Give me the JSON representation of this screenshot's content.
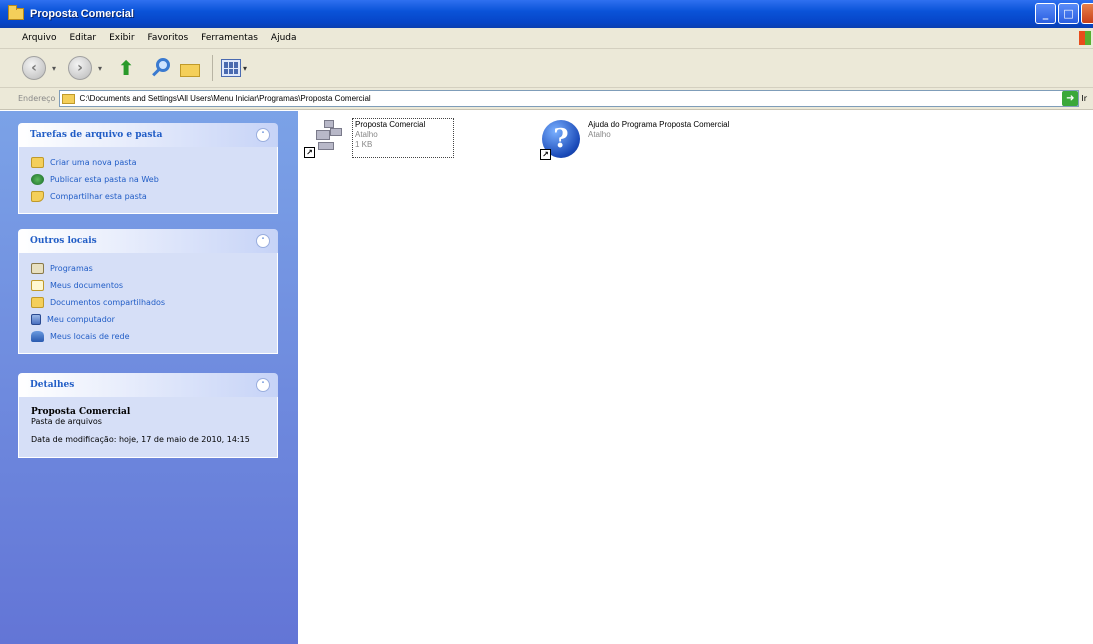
{
  "window": {
    "title": "Proposta Comercial",
    "buttons": [
      "_",
      "□",
      "X"
    ]
  },
  "menu": [
    "Arquivo",
    "Editar",
    "Exibir",
    "Favoritos",
    "Ferramentas",
    "Ajuda"
  ],
  "address": {
    "label": "Endereço",
    "path": "C:\\Documents and Settings\\All Users\\Menu Iniciar\\Programas\\Proposta Comercial",
    "go_label": "Ir"
  },
  "tasks_panel": {
    "title": "Tarefas de arquivo e pasta",
    "items": [
      {
        "label": "Criar uma nova pasta",
        "icon": "new-folder-icon"
      },
      {
        "label": "Publicar esta pasta na Web",
        "icon": "globe-icon"
      },
      {
        "label": "Compartilhar esta pasta",
        "icon": "share-folder-icon"
      }
    ]
  },
  "places_panel": {
    "title": "Outros locais",
    "items": [
      {
        "label": "Programas",
        "icon": "programs-icon"
      },
      {
        "label": "Meus documentos",
        "icon": "documents-icon"
      },
      {
        "label": "Documentos compartilhados",
        "icon": "shared-documents-icon"
      },
      {
        "label": "Meu computador",
        "icon": "computer-icon"
      },
      {
        "label": "Meus locais de rede",
        "icon": "network-icon"
      }
    ]
  },
  "details_panel": {
    "title": "Detalhes",
    "name": "Proposta Comercial",
    "type": "Pasta de arquivos",
    "modified": "Data de modificação: hoje, 17 de maio de 2010, 14:15"
  },
  "files": [
    {
      "name": "Proposta Comercial",
      "type": "Atalho",
      "size": "1 KB",
      "icon": "program-shortcut-icon"
    },
    {
      "name": "Ajuda do Programa Proposta Comercial",
      "type": "Atalho",
      "icon": "help-icon"
    }
  ]
}
